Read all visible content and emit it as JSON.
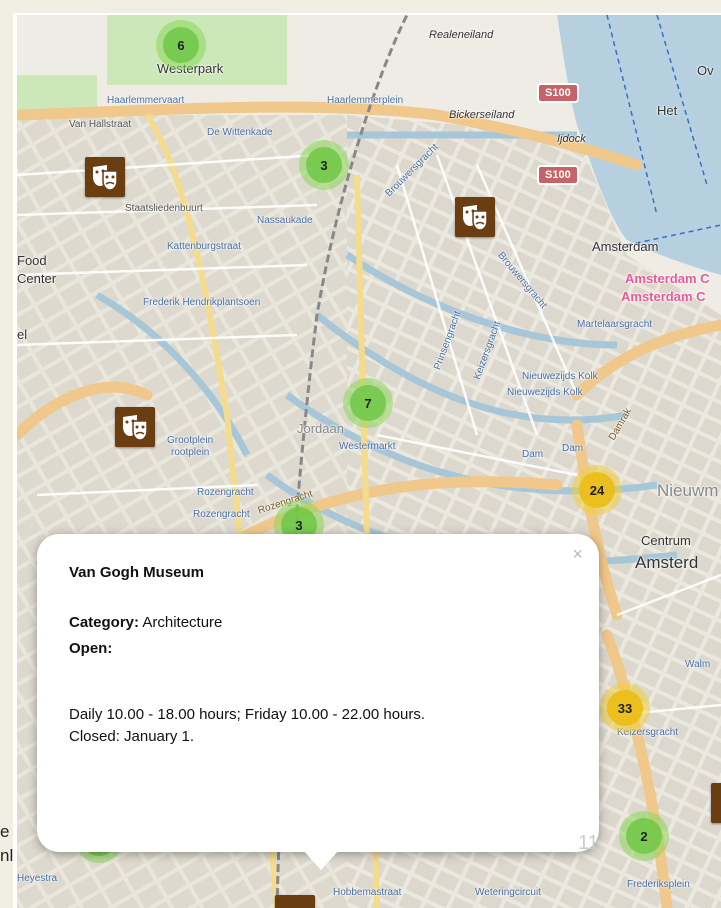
{
  "map": {
    "labels": {
      "westerpark": "Westerpark",
      "realeneiland": "Realeneiland",
      "haarlemmervaart": "Haarlemmervaart",
      "haarlemmerplein": "Haarlemmerplein",
      "bickerseiland": "Bickerseiland",
      "vanhallstraat": "Van Hallstraat",
      "dewittenkade": "De Wittenkade",
      "staatsliedenbuurt": "Staatsliedenbuurt",
      "nassaukade": "Nassaukade",
      "kattenburgstraat": "Kattenburgstraat",
      "food": "Food",
      "center": "Center",
      "frederik": "Frederik Hendrikplantsoen",
      "el": "el",
      "jordaan": "Jordaan",
      "westermarkt": "Westermarkt",
      "rozengracht1": "Rozengracht",
      "rozengracht2": "Rozengracht",
      "rozengracht3": "Rozengracht",
      "grootplein": "Grootplein",
      "rootplein": "rootplein",
      "brouwersgracht1": "Brouwersgracht",
      "brouwersgracht2": "Brouwersgracht",
      "prinsengracht": "Prinsengracht",
      "keizersgracht": "Keizersgracht",
      "amsterdam": "Amsterdam",
      "amsterdam_c1": "Amsterdam C",
      "amsterdam_c2": "Amsterdam C",
      "dock": "Ijdock",
      "het": "Het",
      "ov": "Ov",
      "martelaarsgracht": "Martelaarsgracht",
      "nieuwezijds1": "Nieuwezijds Kolk",
      "nieuwezijds2": "Nieuwezijds Kolk",
      "dam1": "Dam",
      "dam2": "Dam",
      "damrak": "Damrak",
      "nieuwm": "Nieuwm",
      "centrum": "Centrum",
      "amsterd": "Amsterd",
      "keizersgracht2": "Keizersgracht",
      "walm": "Walm",
      "heyestra": "Heyestra",
      "hobbemastraat": "Hobbemastraat",
      "weteringcircuit": "Weteringcircuit",
      "frederiksplein": "Frederiksplein"
    },
    "badges": [
      "S100",
      "S100"
    ],
    "clusters": [
      {
        "count": "6",
        "color": "green"
      },
      {
        "count": "3",
        "color": "green"
      },
      {
        "count": "7",
        "color": "green"
      },
      {
        "count": "3",
        "color": "green"
      },
      {
        "count": "24",
        "color": "yellow"
      },
      {
        "count": "33",
        "color": "yellow"
      },
      {
        "count": "2",
        "color": "green"
      },
      {
        "count": "3",
        "color": "green"
      }
    ],
    "marker_icon": "theater-masks-icon"
  },
  "popup": {
    "title": "Van Gogh Museum",
    "category_label": "Category:",
    "category_value": "Architecture",
    "open_label": "Open:",
    "hours_line1": "Daily 10.00 - 18.00 hours; Friday 10.00 - 22.00 hours.",
    "hours_line2": "Closed: January 1.",
    "close_symbol": "×"
  },
  "slide_number": "11",
  "edge_text": {
    "top": "e",
    "bottom": "nl"
  },
  "colors": {
    "marker": "#6b3e12",
    "cluster_green": "#6ec846",
    "cluster_yellow": "#ebbe14",
    "canal": "#a7c6d8",
    "major_road": "#f0c88c"
  }
}
